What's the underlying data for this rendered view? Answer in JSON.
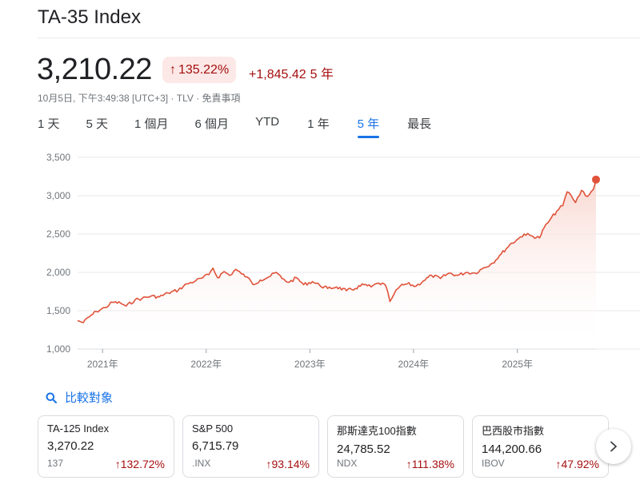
{
  "title": "TA-35 Index",
  "quote": {
    "price": "3,210.22",
    "change_pct": "135.22%",
    "change_abs": "+1,845.42",
    "period": "5 年",
    "meta": "10月5日, 下午3:49:38 [UTC+3] · TLV · 免責事項"
  },
  "tabs": [
    {
      "label": "1 天",
      "active": false
    },
    {
      "label": "5 天",
      "active": false
    },
    {
      "label": "1 個月",
      "active": false
    },
    {
      "label": "6 個月",
      "active": false
    },
    {
      "label": "YTD",
      "active": false
    },
    {
      "label": "1 年",
      "active": false
    },
    {
      "label": "5 年",
      "active": true
    },
    {
      "label": "最長",
      "active": false
    }
  ],
  "compare_label": "比較對象",
  "colors": {
    "line": "#e0533a",
    "fill_top": "#f8d3cc",
    "negative": "#a50e0e",
    "accent": "#1a73e8",
    "grid": "#e8eaed"
  },
  "icons": {
    "compare": "search-icon",
    "next": "chevron-right-icon",
    "up": "arrow-up-icon"
  },
  "chart_data": {
    "type": "area",
    "ylim": [
      1000,
      3500
    ],
    "yticks": [
      1000,
      1500,
      2000,
      2500,
      3000,
      3500
    ],
    "ytick_labels": [
      "1,000",
      "1,500",
      "2,000",
      "2,500",
      "3,000",
      "3,500"
    ],
    "x_range": [
      "2020-10-05",
      "2025-10-05"
    ],
    "xticks": [
      "2021-01-01",
      "2022-01-01",
      "2023-01-01",
      "2024-01-01",
      "2025-01-01"
    ],
    "xtick_labels": [
      "2021年",
      "2022年",
      "2023年",
      "2024年",
      "2025年"
    ],
    "grid": true,
    "points": [
      [
        "2020-10-05",
        1370
      ],
      [
        "2020-10-25",
        1345
      ],
      [
        "2020-11-15",
        1420
      ],
      [
        "2020-12-10",
        1490
      ],
      [
        "2021-01-10",
        1540
      ],
      [
        "2021-02-05",
        1610
      ],
      [
        "2021-03-05",
        1600
      ],
      [
        "2021-03-25",
        1560
      ],
      [
        "2021-04-25",
        1640
      ],
      [
        "2021-05-20",
        1660
      ],
      [
        "2021-06-20",
        1690
      ],
      [
        "2021-07-20",
        1680
      ],
      [
        "2021-08-20",
        1730
      ],
      [
        "2021-09-25",
        1770
      ],
      [
        "2021-10-25",
        1850
      ],
      [
        "2021-11-25",
        1890
      ],
      [
        "2021-12-20",
        1930
      ],
      [
        "2022-01-10",
        1970
      ],
      [
        "2022-01-25",
        2055
      ],
      [
        "2022-02-10",
        1930
      ],
      [
        "2022-03-05",
        2010
      ],
      [
        "2022-03-25",
        1960
      ],
      [
        "2022-04-15",
        2040
      ],
      [
        "2022-05-05",
        1980
      ],
      [
        "2022-05-25",
        1940
      ],
      [
        "2022-06-15",
        1840
      ],
      [
        "2022-07-10",
        1900
      ],
      [
        "2022-08-15",
        1950
      ],
      [
        "2022-09-05",
        2000
      ],
      [
        "2022-09-25",
        1920
      ],
      [
        "2022-10-20",
        1870
      ],
      [
        "2022-11-15",
        1930
      ],
      [
        "2022-12-10",
        1840
      ],
      [
        "2023-01-10",
        1880
      ],
      [
        "2023-02-05",
        1830
      ],
      [
        "2023-03-05",
        1790
      ],
      [
        "2023-04-05",
        1810
      ],
      [
        "2023-05-10",
        1760
      ],
      [
        "2023-06-10",
        1790
      ],
      [
        "2023-07-10",
        1840
      ],
      [
        "2023-08-05",
        1810
      ],
      [
        "2023-09-01",
        1860
      ],
      [
        "2023-09-25",
        1830
      ],
      [
        "2023-10-10",
        1620
      ],
      [
        "2023-10-25",
        1720
      ],
      [
        "2023-11-15",
        1820
      ],
      [
        "2023-12-10",
        1850
      ],
      [
        "2024-01-10",
        1820
      ],
      [
        "2024-02-05",
        1890
      ],
      [
        "2024-03-05",
        1960
      ],
      [
        "2024-04-05",
        1920
      ],
      [
        "2024-05-05",
        1990
      ],
      [
        "2024-06-05",
        1960
      ],
      [
        "2024-07-05",
        2000
      ],
      [
        "2024-08-05",
        1990
      ],
      [
        "2024-09-05",
        2060
      ],
      [
        "2024-10-05",
        2120
      ],
      [
        "2024-11-05",
        2240
      ],
      [
        "2024-12-05",
        2360
      ],
      [
        "2025-01-05",
        2440
      ],
      [
        "2025-01-25",
        2500
      ],
      [
        "2025-02-25",
        2470
      ],
      [
        "2025-03-20",
        2450
      ],
      [
        "2025-04-05",
        2580
      ],
      [
        "2025-04-25",
        2680
      ],
      [
        "2025-05-20",
        2800
      ],
      [
        "2025-06-10",
        2870
      ],
      [
        "2025-06-25",
        3050
      ],
      [
        "2025-07-10",
        3000
      ],
      [
        "2025-07-25",
        2910
      ],
      [
        "2025-08-15",
        3070
      ],
      [
        "2025-09-05",
        2990
      ],
      [
        "2025-09-25",
        3080
      ],
      [
        "2025-10-05",
        3210
      ]
    ]
  },
  "cards": [
    {
      "name": "TA-125 Index",
      "value": "3,270.22",
      "ticker": "137",
      "pct": "132.72%"
    },
    {
      "name": "S&P 500",
      "value": "6,715.79",
      "ticker": ".INX",
      "pct": "93.14%"
    },
    {
      "name": "那斯達克100指數",
      "value": "24,785.52",
      "ticker": "NDX",
      "pct": "111.38%"
    },
    {
      "name": "巴西股市指數",
      "value": "144,200.66",
      "ticker": "IBOV",
      "pct": "47.92%"
    }
  ]
}
